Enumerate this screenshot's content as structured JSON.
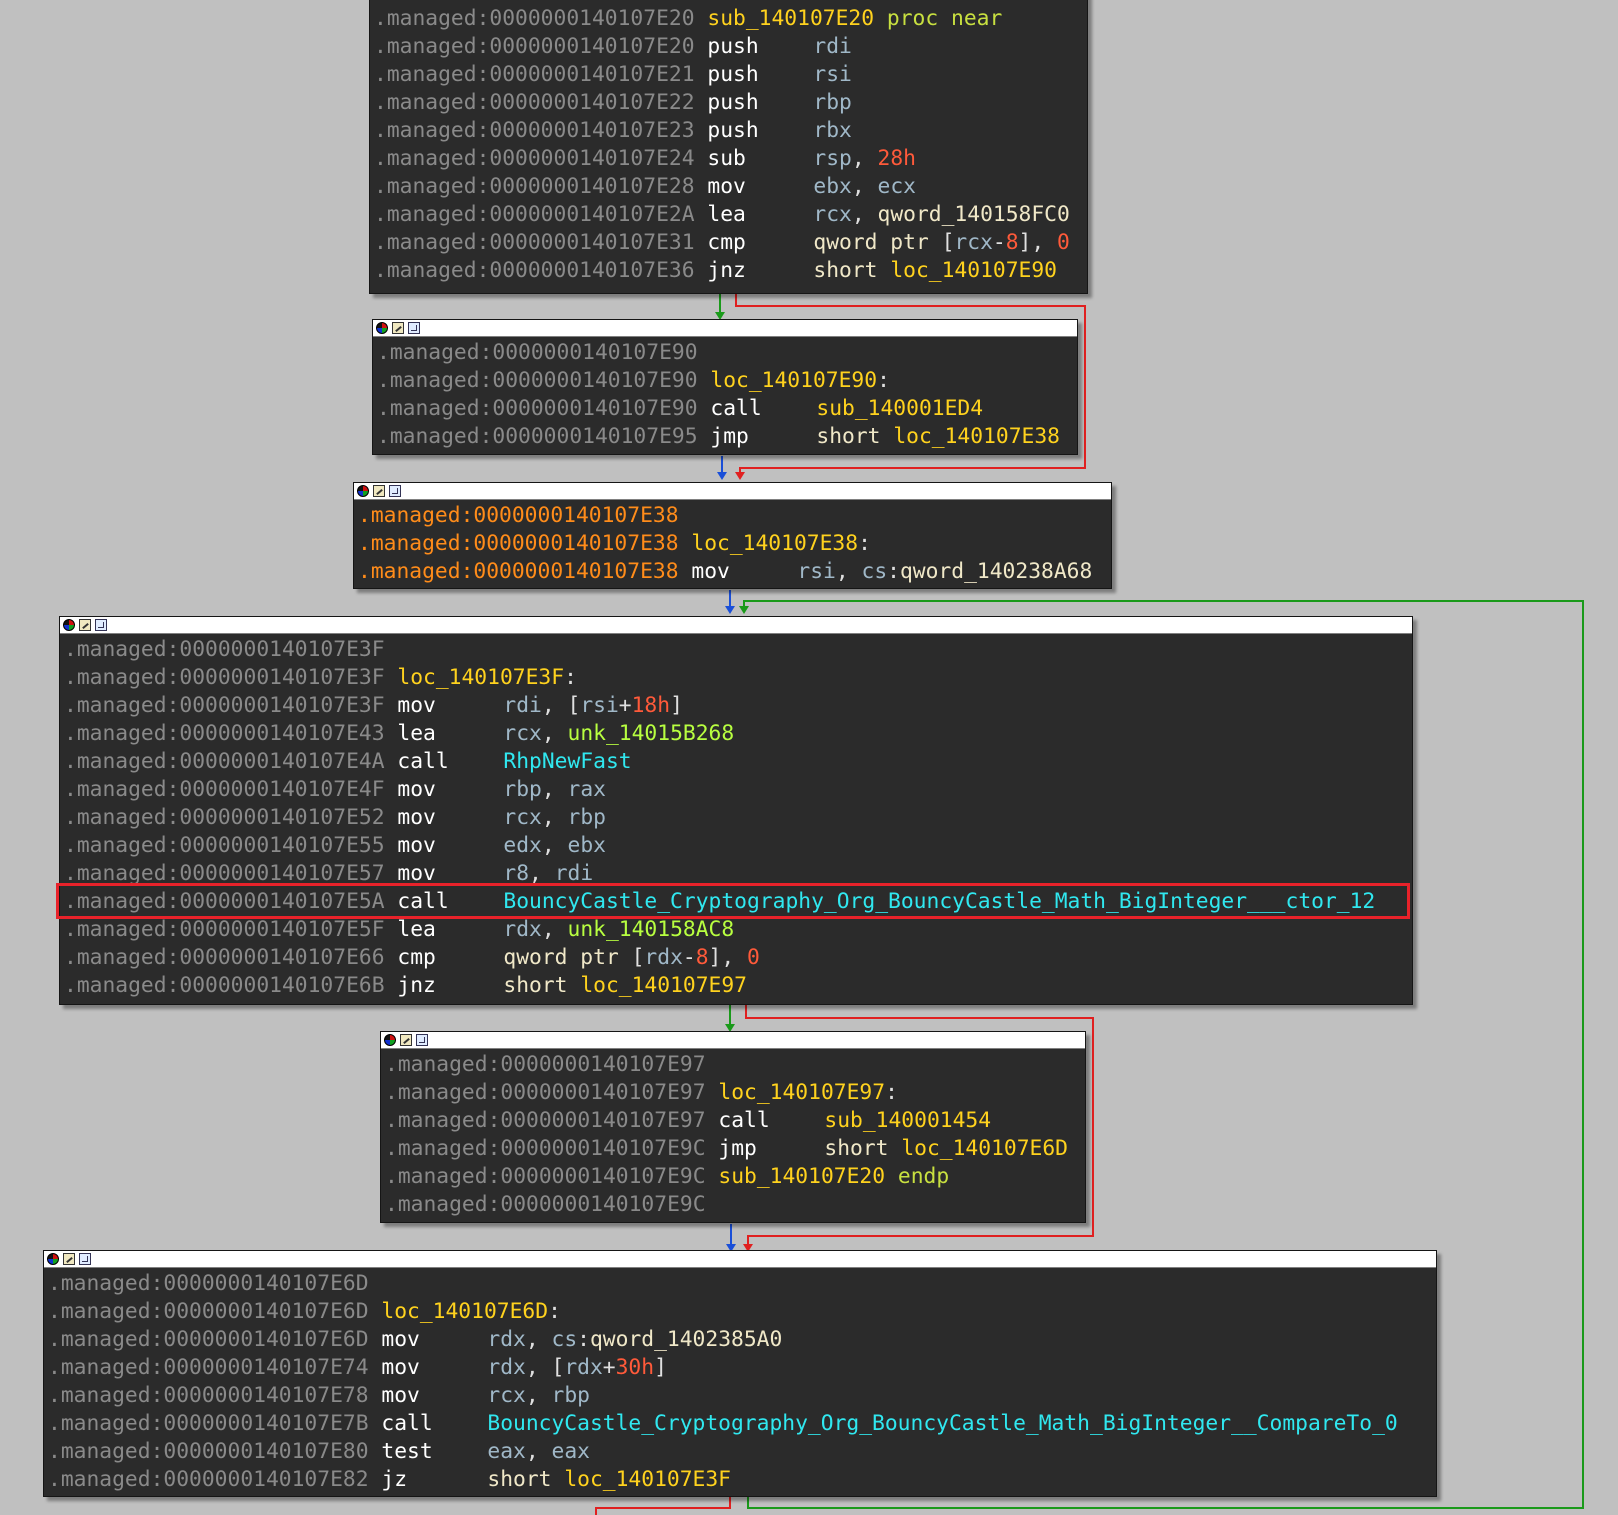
{
  "colors": {
    "background": "#c0c0c0",
    "block_bg": "#2b2b2b",
    "edge_true": "#1a9a1a",
    "edge_false": "#e02020",
    "edge_uncond": "#1a4fd8",
    "highlight_box": "#e8222a"
  },
  "icons": [
    "color-icon",
    "edit-icon",
    "graph-icon"
  ],
  "blocks": [
    {
      "id": "b0",
      "lines": [
        {
          "addr": ".managed:0000000140107E20",
          "parts": [
            [
              "lbl",
              "sub_140107E20"
            ],
            [
              "plain",
              " "
            ],
            [
              "kw",
              "proc near"
            ]
          ]
        },
        {
          "addr": ".managed:0000000140107E20",
          "mn": "push",
          "parts": [
            [
              "op",
              "rdi"
            ]
          ]
        },
        {
          "addr": ".managed:0000000140107E21",
          "mn": "push",
          "parts": [
            [
              "op",
              "rsi"
            ]
          ]
        },
        {
          "addr": ".managed:0000000140107E22",
          "mn": "push",
          "parts": [
            [
              "op",
              "rbp"
            ]
          ]
        },
        {
          "addr": ".managed:0000000140107E23",
          "mn": "push",
          "parts": [
            [
              "op",
              "rbx"
            ]
          ]
        },
        {
          "addr": ".managed:0000000140107E24",
          "mn": "sub",
          "parts": [
            [
              "op",
              "rsp"
            ],
            [
              "plain",
              ", "
            ],
            [
              "num",
              "28h"
            ]
          ]
        },
        {
          "addr": ".managed:0000000140107E28",
          "mn": "mov",
          "parts": [
            [
              "op",
              "ebx"
            ],
            [
              "plain",
              ", "
            ],
            [
              "op",
              "ecx"
            ]
          ]
        },
        {
          "addr": ".managed:0000000140107E2A",
          "mn": "lea",
          "parts": [
            [
              "op",
              "rcx"
            ],
            [
              "plain",
              ", "
            ],
            [
              "sym",
              "qword_140158FC0"
            ]
          ]
        },
        {
          "addr": ".managed:0000000140107E31",
          "mn": "cmp",
          "parts": [
            [
              "sym",
              "qword ptr "
            ],
            [
              "plain",
              "["
            ],
            [
              "op",
              "rcx"
            ],
            [
              "plain",
              "-"
            ],
            [
              "num",
              "8"
            ],
            [
              "plain",
              "], "
            ],
            [
              "num",
              "0"
            ]
          ]
        },
        {
          "addr": ".managed:0000000140107E36",
          "mn": "jnz",
          "parts": [
            [
              "sym",
              "short "
            ],
            [
              "lbl",
              "loc_140107E90"
            ]
          ]
        }
      ]
    },
    {
      "id": "b1",
      "lines": [
        {
          "addr": ".managed:0000000140107E90",
          "parts": []
        },
        {
          "addr": ".managed:0000000140107E90",
          "parts": [
            [
              "lbl",
              "loc_140107E90"
            ],
            [
              "plain",
              ":"
            ]
          ]
        },
        {
          "addr": ".managed:0000000140107E90",
          "mn": "call",
          "parts": [
            [
              "lbl",
              "sub_140001ED4"
            ]
          ]
        },
        {
          "addr": ".managed:0000000140107E95",
          "mn": "jmp",
          "parts": [
            [
              "sym",
              "short "
            ],
            [
              "lbl",
              "loc_140107E38"
            ]
          ]
        }
      ]
    },
    {
      "id": "b2",
      "highlight_addr": true,
      "lines": [
        {
          "addr": ".managed:0000000140107E38",
          "parts": []
        },
        {
          "addr": ".managed:0000000140107E38",
          "parts": [
            [
              "lbl",
              "loc_140107E38"
            ],
            [
              "plain",
              ":"
            ]
          ]
        },
        {
          "addr": ".managed:0000000140107E38",
          "mn": "mov",
          "parts": [
            [
              "op",
              "rsi"
            ],
            [
              "plain",
              ", "
            ],
            [
              "op",
              "cs"
            ],
            [
              "plain",
              ":"
            ],
            [
              "sym",
              "qword_140238A68"
            ]
          ]
        }
      ]
    },
    {
      "id": "b3",
      "lines": [
        {
          "addr": ".managed:0000000140107E3F",
          "parts": []
        },
        {
          "addr": ".managed:0000000140107E3F",
          "parts": [
            [
              "lbl",
              "loc_140107E3F"
            ],
            [
              "plain",
              ":"
            ]
          ]
        },
        {
          "addr": ".managed:0000000140107E3F",
          "mn": "mov",
          "parts": [
            [
              "op",
              "rdi"
            ],
            [
              "plain",
              ", ["
            ],
            [
              "op",
              "rsi"
            ],
            [
              "plain",
              "+"
            ],
            [
              "num",
              "18h"
            ],
            [
              "plain",
              "]"
            ]
          ]
        },
        {
          "addr": ".managed:0000000140107E43",
          "mn": "lea",
          "parts": [
            [
              "op",
              "rcx"
            ],
            [
              "plain",
              ", "
            ],
            [
              "data",
              "unk_14015B268"
            ]
          ]
        },
        {
          "addr": ".managed:0000000140107E4A",
          "mn": "call",
          "parts": [
            [
              "fn",
              "RhpNewFast"
            ]
          ]
        },
        {
          "addr": ".managed:0000000140107E4F",
          "mn": "mov",
          "parts": [
            [
              "op",
              "rbp"
            ],
            [
              "plain",
              ", "
            ],
            [
              "op",
              "rax"
            ]
          ]
        },
        {
          "addr": ".managed:0000000140107E52",
          "mn": "mov",
          "parts": [
            [
              "op",
              "rcx"
            ],
            [
              "plain",
              ", "
            ],
            [
              "op",
              "rbp"
            ]
          ]
        },
        {
          "addr": ".managed:0000000140107E55",
          "mn": "mov",
          "parts": [
            [
              "op",
              "edx"
            ],
            [
              "plain",
              ", "
            ],
            [
              "op",
              "ebx"
            ]
          ]
        },
        {
          "addr": ".managed:0000000140107E57",
          "mn": "mov",
          "parts": [
            [
              "op",
              "r8"
            ],
            [
              "plain",
              ", "
            ],
            [
              "op",
              "rdi"
            ]
          ]
        },
        {
          "addr": ".managed:0000000140107E5A",
          "mn": "call",
          "selected": true,
          "parts": [
            [
              "fn",
              "BouncyCastle_Cryptography_Org_BouncyCastle_Math_BigInteger___ctor_12"
            ]
          ]
        },
        {
          "addr": ".managed:0000000140107E5F",
          "mn": "lea",
          "parts": [
            [
              "op",
              "rdx"
            ],
            [
              "plain",
              ", "
            ],
            [
              "data",
              "unk_140158AC8"
            ]
          ]
        },
        {
          "addr": ".managed:0000000140107E66",
          "mn": "cmp",
          "parts": [
            [
              "sym",
              "qword ptr "
            ],
            [
              "plain",
              "["
            ],
            [
              "op",
              "rdx"
            ],
            [
              "plain",
              "-"
            ],
            [
              "num",
              "8"
            ],
            [
              "plain",
              "], "
            ],
            [
              "num",
              "0"
            ]
          ]
        },
        {
          "addr": ".managed:0000000140107E6B",
          "mn": "jnz",
          "parts": [
            [
              "sym",
              "short "
            ],
            [
              "lbl",
              "loc_140107E97"
            ]
          ]
        }
      ]
    },
    {
      "id": "b4",
      "lines": [
        {
          "addr": ".managed:0000000140107E97",
          "parts": []
        },
        {
          "addr": ".managed:0000000140107E97",
          "parts": [
            [
              "lbl",
              "loc_140107E97"
            ],
            [
              "plain",
              ":"
            ]
          ]
        },
        {
          "addr": ".managed:0000000140107E97",
          "mn": "call",
          "parts": [
            [
              "lbl",
              "sub_140001454"
            ]
          ]
        },
        {
          "addr": ".managed:0000000140107E9C",
          "mn": "jmp",
          "parts": [
            [
              "sym",
              "short "
            ],
            [
              "lbl",
              "loc_140107E6D"
            ]
          ]
        },
        {
          "addr": ".managed:0000000140107E9C",
          "parts": [
            [
              "lbl",
              "sub_140107E20"
            ],
            [
              "plain",
              " "
            ],
            [
              "kw",
              "endp"
            ]
          ]
        },
        {
          "addr": ".managed:0000000140107E9C",
          "parts": []
        }
      ]
    },
    {
      "id": "b5",
      "lines": [
        {
          "addr": ".managed:0000000140107E6D",
          "parts": []
        },
        {
          "addr": ".managed:0000000140107E6D",
          "parts": [
            [
              "lbl",
              "loc_140107E6D"
            ],
            [
              "plain",
              ":"
            ]
          ]
        },
        {
          "addr": ".managed:0000000140107E6D",
          "mn": "mov",
          "parts": [
            [
              "op",
              "rdx"
            ],
            [
              "plain",
              ", "
            ],
            [
              "op",
              "cs"
            ],
            [
              "plain",
              ":"
            ],
            [
              "sym",
              "qword_1402385A0"
            ]
          ]
        },
        {
          "addr": ".managed:0000000140107E74",
          "mn": "mov",
          "parts": [
            [
              "op",
              "rdx"
            ],
            [
              "plain",
              ", ["
            ],
            [
              "op",
              "rdx"
            ],
            [
              "plain",
              "+"
            ],
            [
              "num",
              "30h"
            ],
            [
              "plain",
              "]"
            ]
          ]
        },
        {
          "addr": ".managed:0000000140107E78",
          "mn": "mov",
          "parts": [
            [
              "op",
              "rcx"
            ],
            [
              "plain",
              ", "
            ],
            [
              "op",
              "rbp"
            ]
          ]
        },
        {
          "addr": ".managed:0000000140107E7B",
          "mn": "call",
          "parts": [
            [
              "fn",
              "BouncyCastle_Cryptography_Org_BouncyCastle_Math_BigInteger__CompareTo_0"
            ]
          ]
        },
        {
          "addr": ".managed:0000000140107E80",
          "mn": "test",
          "parts": [
            [
              "op",
              "eax"
            ],
            [
              "plain",
              ", "
            ],
            [
              "op",
              "eax"
            ]
          ]
        },
        {
          "addr": ".managed:0000000140107E82",
          "mn": "jz",
          "parts": [
            [
              "sym",
              "short "
            ],
            [
              "lbl",
              "loc_140107E3F"
            ]
          ]
        }
      ]
    }
  ]
}
